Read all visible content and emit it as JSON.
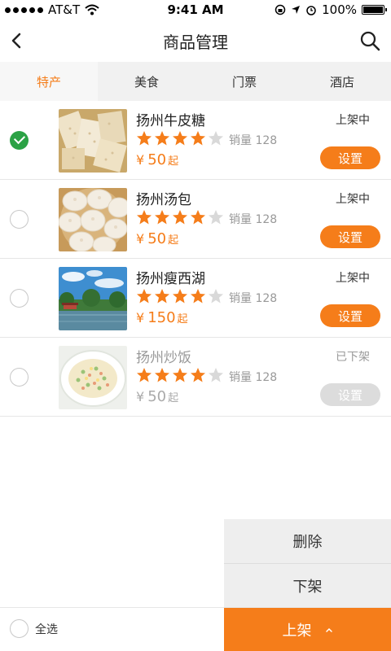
{
  "status_bar": {
    "carrier": "AT&T",
    "time": "9:41 AM",
    "battery": "100%"
  },
  "nav": {
    "title": "商品管理",
    "back_icon": "chevron-left-icon",
    "search_icon": "search-icon"
  },
  "tabs": [
    {
      "label": "特产",
      "active": true
    },
    {
      "label": "美食",
      "active": false
    },
    {
      "label": "门票",
      "active": false
    },
    {
      "label": "酒店",
      "active": false
    }
  ],
  "products": [
    {
      "name": "扬州牛皮糖",
      "rating": 4,
      "sales_label": "销量",
      "sales": "128",
      "currency": "¥",
      "price": "50",
      "price_suffix": "起",
      "status": "上架中",
      "action": "设置",
      "selected": true,
      "on_shelf": true
    },
    {
      "name": "扬州汤包",
      "rating": 4,
      "sales_label": "销量",
      "sales": "128",
      "currency": "¥",
      "price": "50",
      "price_suffix": "起",
      "status": "上架中",
      "action": "设置",
      "selected": false,
      "on_shelf": true
    },
    {
      "name": "扬州瘦西湖",
      "rating": 4,
      "sales_label": "销量",
      "sales": "128",
      "currency": "¥",
      "price": "150",
      "price_suffix": "起",
      "status": "上架中",
      "action": "设置",
      "selected": false,
      "on_shelf": true
    },
    {
      "name": "扬州炒饭",
      "rating": 4,
      "sales_label": "销量",
      "sales": "128",
      "currency": "¥",
      "price": "50",
      "price_suffix": "起",
      "status": "已下架",
      "action": "设置",
      "selected": false,
      "on_shelf": false
    }
  ],
  "popup_menu": {
    "delete": "删除",
    "unshelve": "下架"
  },
  "bottom_bar": {
    "select_all": "全选",
    "main_action": "上架"
  },
  "colors": {
    "accent": "#f57d1a",
    "selected_check": "#2ba245",
    "disabled": "#dcdcdc"
  }
}
